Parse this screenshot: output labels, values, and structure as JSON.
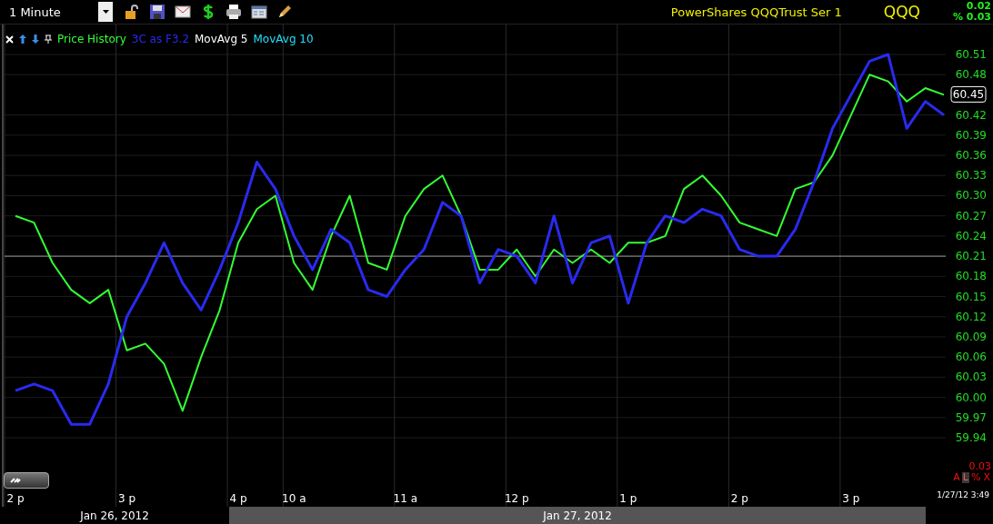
{
  "toolbar": {
    "interval": "1 Minute",
    "security_name": "PowerShares QQQTrust Ser 1",
    "symbol": "QQQ",
    "change": "0.02",
    "change_percent": "% 0.03"
  },
  "legend": [
    {
      "label": "MovAvg 5",
      "color": "#ffffff"
    },
    {
      "label": "MovAvg 10",
      "color": "#22e0ff"
    }
  ],
  "chart": {
    "chart_data": {
      "type": "line",
      "categories": [
        "2 p",
        null,
        null,
        null,
        null,
        null,
        "3 p",
        null,
        null,
        null,
        null,
        null,
        "4 p",
        null,
        null,
        "10 a",
        null,
        null,
        null,
        null,
        null,
        "11 a",
        null,
        null,
        null,
        null,
        null,
        "12 p",
        null,
        null,
        null,
        null,
        null,
        "1 p",
        null,
        null,
        null,
        null,
        null,
        "2 p",
        null,
        null,
        null,
        null,
        null,
        "3 p",
        null,
        null,
        null,
        null,
        null
      ],
      "series": [
        {
          "name": "Price History",
          "color": "#33ff33",
          "values": [
            60.27,
            60.26,
            60.2,
            60.16,
            60.14,
            60.16,
            60.07,
            60.08,
            60.05,
            59.98,
            60.06,
            60.13,
            60.23,
            60.28,
            60.3,
            60.2,
            60.16,
            60.24,
            60.3,
            60.2,
            60.19,
            60.27,
            60.31,
            60.33,
            60.27,
            60.19,
            60.19,
            60.22,
            60.18,
            60.22,
            60.2,
            60.22,
            60.2,
            60.23,
            60.23,
            60.24,
            60.31,
            60.33,
            60.3,
            60.26,
            60.25,
            60.24,
            60.31,
            60.32,
            60.36,
            60.42,
            60.48,
            60.47,
            60.44,
            60.46,
            60.45
          ]
        },
        {
          "name": "3C as F3.2",
          "color": "#2a2af0",
          "values": [
            60.01,
            60.02,
            60.01,
            59.96,
            59.96,
            60.02,
            60.12,
            60.17,
            60.23,
            60.17,
            60.13,
            60.19,
            60.26,
            60.35,
            60.31,
            60.24,
            60.19,
            60.25,
            60.23,
            60.16,
            60.15,
            60.19,
            60.22,
            60.29,
            60.27,
            60.17,
            60.22,
            60.21,
            60.17,
            60.27,
            60.17,
            60.23,
            60.24,
            60.14,
            60.23,
            60.27,
            60.26,
            60.28,
            60.27,
            60.22,
            60.21,
            60.21,
            60.25,
            60.32,
            60.4,
            60.45,
            60.5,
            60.51,
            60.4,
            60.44,
            60.42
          ]
        }
      ],
      "ylim": [
        59.94,
        60.51
      ],
      "ref_lines": [
        {
          "axis": "y",
          "value": 60.21
        }
      ],
      "grid": true,
      "yticks": [
        {
          "value": 60.51,
          "label": "60.51"
        },
        {
          "value": 60.48,
          "label": "60.48"
        },
        {
          "value": 60.42,
          "label": "60.42"
        },
        {
          "value": 60.39,
          "label": "60.39"
        },
        {
          "value": 60.36,
          "label": "60.36"
        },
        {
          "value": 60.33,
          "label": "60.33"
        },
        {
          "value": 60.3,
          "label": "60.30"
        },
        {
          "value": 60.27,
          "label": "60.27"
        },
        {
          "value": 60.24,
          "label": "60.24"
        },
        {
          "value": 60.21,
          "label": "60.21"
        },
        {
          "value": 60.18,
          "label": "60.18"
        },
        {
          "value": 60.15,
          "label": "60.15"
        },
        {
          "value": 60.12,
          "label": "60.12"
        },
        {
          "value": 60.09,
          "label": "60.09"
        },
        {
          "value": 60.06,
          "label": "60.06"
        },
        {
          "value": 60.03,
          "label": "60.03"
        },
        {
          "value": 60,
          "label": "60.00"
        },
        {
          "value": 59.97,
          "label": "59.97"
        },
        {
          "value": 59.94,
          "label": "59.94"
        }
      ]
    },
    "last_price": "60.45",
    "scale_value": "0.03",
    "scale_buttons": [
      {
        "label": "A",
        "selected": false
      },
      {
        "label": "L",
        "selected": true
      },
      {
        "label": "%",
        "selected": false
      },
      {
        "label": "X",
        "selected": false
      }
    ],
    "timestamp": "1/27/12 3:49"
  },
  "date_bar": [
    {
      "label": "Jan 26, 2012",
      "selected": false
    },
    {
      "label": "Jan 27, 2012",
      "selected": true
    }
  ]
}
